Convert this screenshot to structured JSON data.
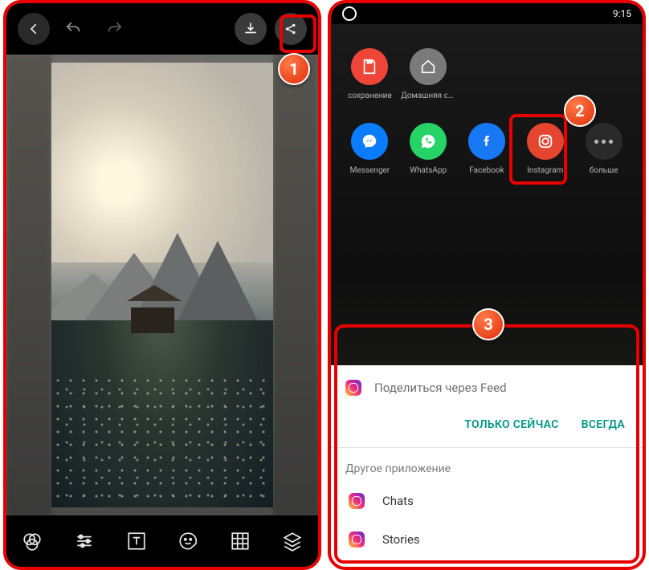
{
  "status": {
    "time": "9:15"
  },
  "editor_tools": [
    "filters",
    "adjust",
    "text",
    "sticker",
    "pixelate",
    "layers"
  ],
  "share_row1": [
    {
      "key": "save",
      "label": "сохранение",
      "cls": "b-red"
    },
    {
      "key": "home",
      "label": "Домашняя ст...",
      "cls": "b-grey"
    }
  ],
  "share_row2": [
    {
      "key": "messenger",
      "label": "Messenger",
      "cls": "b-mess"
    },
    {
      "key": "whatsapp",
      "label": "WhatsApp",
      "cls": "b-wa"
    },
    {
      "key": "facebook",
      "label": "Facebook",
      "cls": "b-fb"
    },
    {
      "key": "instagram",
      "label": "Instagram",
      "cls": "b-ig"
    },
    {
      "key": "more",
      "label": "больше",
      "cls": "b-more"
    }
  ],
  "sheet": {
    "title": "Поделиться через Feed",
    "only_now": "ТОЛЬКО СЕЙЧАС",
    "always": "ВСЕГДА",
    "other_app": "Другое приложение",
    "chats": "Chats",
    "stories": "Stories"
  },
  "badges": {
    "b1": "1",
    "b2": "2",
    "b3": "3"
  }
}
